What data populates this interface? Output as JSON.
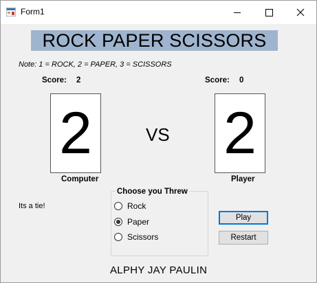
{
  "window": {
    "title": "Form1"
  },
  "heading": "ROCK PAPER SCISSORS",
  "note": "Note: 1 = ROCK, 2 = PAPER, 3 = SCISSORS",
  "computer": {
    "score_label": "Score:",
    "score": "2",
    "throw": "2",
    "label": "Computer"
  },
  "player": {
    "score_label": "Score:",
    "score": "0",
    "throw": "2",
    "label": "Player"
  },
  "vs": "VS",
  "result": "Its a tie!",
  "choice_group": {
    "title": "Choose you Threw",
    "options": [
      {
        "label": "Rock",
        "checked": false
      },
      {
        "label": "Paper",
        "checked": true
      },
      {
        "label": "Scissors",
        "checked": false
      }
    ]
  },
  "buttons": {
    "play": "Play",
    "restart": "Restart"
  },
  "author": "ALPHY JAY PAULIN",
  "colors": {
    "heading_bg": "#9fb4cf",
    "default_button_border": "#0078d7",
    "form_bg": "#f0f0f0"
  }
}
